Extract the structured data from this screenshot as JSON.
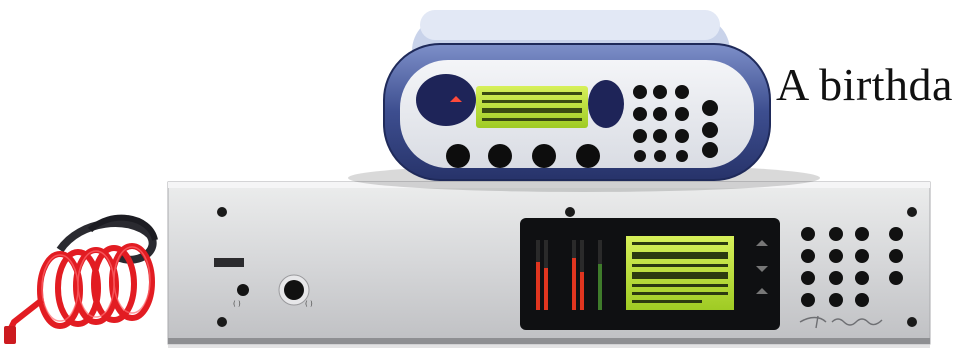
{
  "headline": "A birthda",
  "colors": {
    "background": "#ffffff",
    "codec_body": "#3d4e8f",
    "lcd_green": "#b8e23a",
    "rack_panel": "#d9dadc",
    "cable_red": "#e21c22"
  },
  "codec_unit": {
    "lcd_lines": [
      "",
      "",
      ""
    ]
  },
  "rack_unit": {
    "lcd_lines": [
      "",
      "",
      "",
      "",
      ""
    ],
    "brand_script": "Telos"
  }
}
